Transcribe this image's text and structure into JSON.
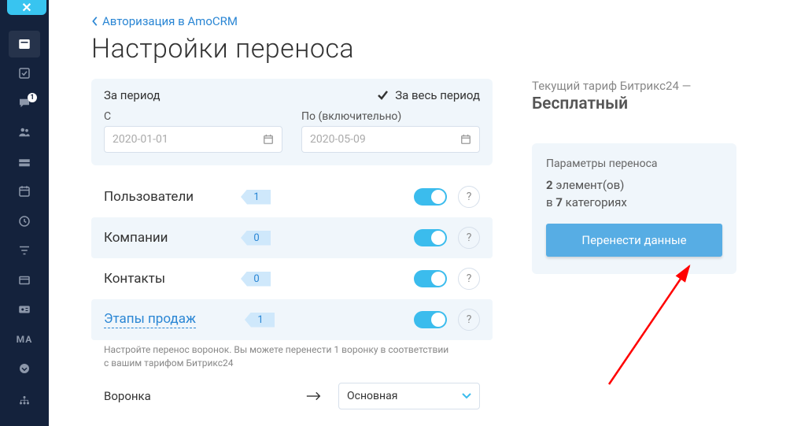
{
  "sidebar": {
    "badge": "1",
    "ma_label": "MA"
  },
  "breadcrumb": {
    "text": "Авторизация в AmoCRM"
  },
  "title": "Настройки переноса",
  "period": {
    "label": "За период",
    "all_label": "За весь период",
    "from_label": "С",
    "to_label": "По (включительно)",
    "from_value": "2020-01-01",
    "to_value": "2020-05-09"
  },
  "categories": {
    "users": {
      "label": "Пользователи",
      "count": "1"
    },
    "companies": {
      "label": "Компании",
      "count": "0"
    },
    "contacts": {
      "label": "Контакты",
      "count": "0"
    },
    "stages": {
      "label": "Этапы продаж",
      "count": "1"
    }
  },
  "hint": "Настройте перенос воронок. Вы можете перенести 1 воронку в соответствии с вашим тарифом Битрикс24",
  "funnel": {
    "label": "Воронка",
    "value": "Основная"
  },
  "help": "?",
  "tariff": {
    "label": "Текущий тариф Битрикс24 —",
    "value": "Бесплатный"
  },
  "params": {
    "title": "Параметры переноса",
    "elements_count": "2",
    "elements_word": "элемент(ов)",
    "in_word": "в",
    "cats_count": "7",
    "cats_word": "категориях",
    "button": "Перенести данные"
  }
}
